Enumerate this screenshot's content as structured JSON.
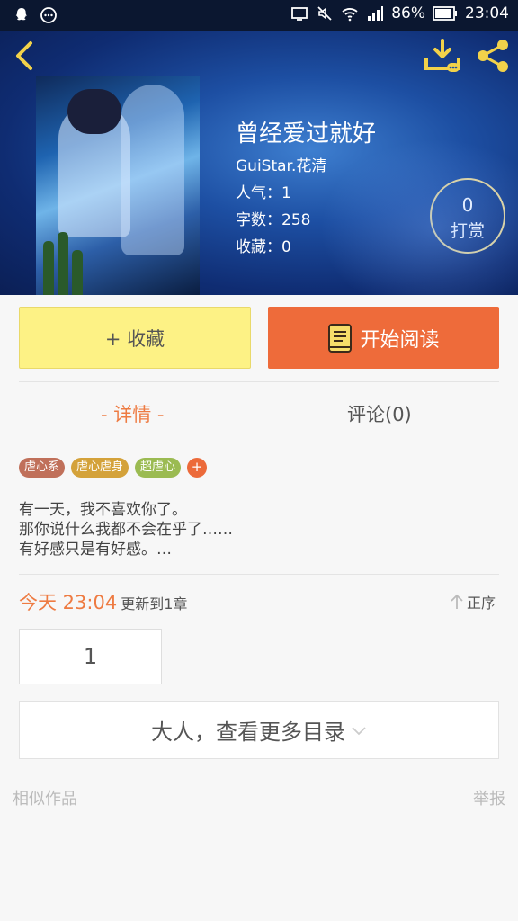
{
  "status_bar": {
    "left_icons": [
      "qq-icon",
      "chat-icon"
    ],
    "battery": "86%",
    "time": "23:04"
  },
  "header": {
    "back_icon": "chevron-left-icon",
    "download_icon": "download-icon",
    "share_icon": "share-icon"
  },
  "book": {
    "title": "曾经爱过就好",
    "author": "GuiStar.花清",
    "popularity": "人气：1",
    "word_count": "字数：258",
    "favorites": "收藏：0"
  },
  "reward": {
    "count": "0",
    "label": "打赏"
  },
  "actions": {
    "favorite_label": "+ 收藏",
    "read_label": "开始阅读",
    "fav_color": "#fdf285",
    "read_color": "#ee6b3a"
  },
  "tabs": {
    "detail": "- 详情 -",
    "comments": "评论(0)",
    "active_color": "#ee7b42"
  },
  "tags": [
    {
      "label": "虐心系",
      "color": "#c0705a"
    },
    {
      "label": "虐心虐身",
      "color": "#d4a23a"
    },
    {
      "label": "超虐心",
      "color": "#9bbb52"
    }
  ],
  "tag_add": "+",
  "description": [
    "有一天，我不喜欢你了。",
    "那你说什么我都不会在乎了……",
    "有好感只是有好感。…"
  ],
  "update": {
    "time": "今天 23:04",
    "text": "更新到1章",
    "sort_label": "正序"
  },
  "chapters": [
    "1"
  ],
  "more_toc": "大人，查看更多目录",
  "footer": {
    "similar": "相似作品",
    "report": "举报"
  }
}
